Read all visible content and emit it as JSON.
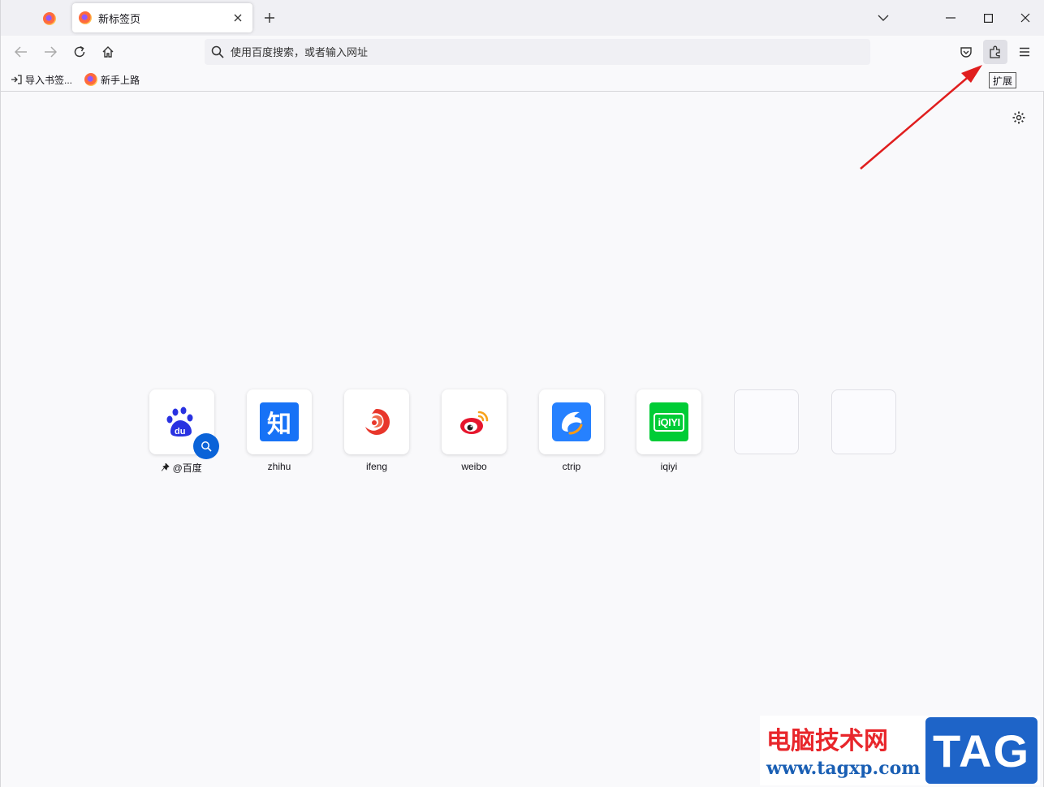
{
  "tabs": [
    {
      "label": "新标签页",
      "active": true
    }
  ],
  "urlbar": {
    "placeholder": "使用百度搜索，或者输入网址"
  },
  "bookmarks": [
    {
      "label": "导入书签..."
    },
    {
      "label": "新手上路"
    }
  ],
  "tooltip": {
    "text": "扩展"
  },
  "shortcuts": [
    {
      "label": "@百度",
      "pinned": true,
      "icon": "baidu-logo"
    },
    {
      "label": "zhihu",
      "icon": "zhihu-logo",
      "glyph": "知"
    },
    {
      "label": "ifeng",
      "icon": "ifeng-logo"
    },
    {
      "label": "weibo",
      "icon": "weibo-logo"
    },
    {
      "label": "ctrip",
      "icon": "ctrip-logo"
    },
    {
      "label": "iqiyi",
      "icon": "iqiyi-logo",
      "glyph": "iQIYI"
    }
  ],
  "watermark": {
    "title": "电脑技术网",
    "url": "www.tagxp.com",
    "tag": "TAG"
  },
  "colors": {
    "accent": "#0a63d8",
    "arrow": "#e01e1e",
    "zhihu": "#1772f6",
    "iqiyi": "#00cc36",
    "ctrip": "#2681ff"
  }
}
